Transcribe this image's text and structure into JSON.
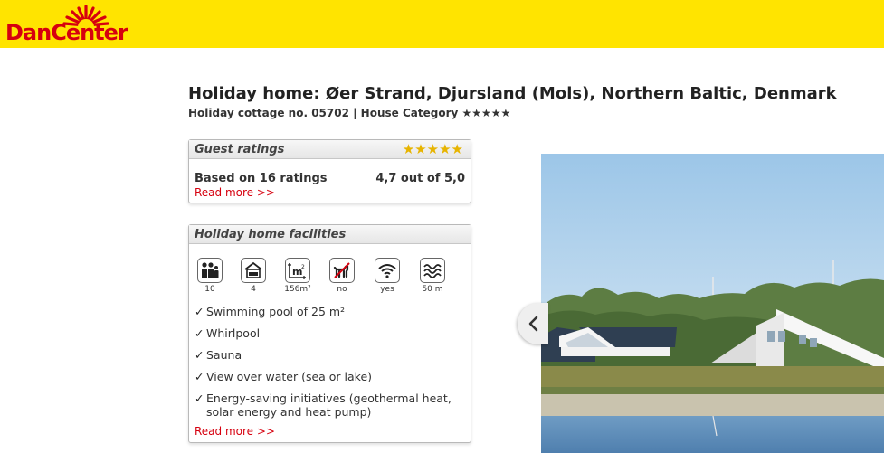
{
  "brand": {
    "name": "DanCenter",
    "color": "#d6000f",
    "bar_color": "#ffe400"
  },
  "property": {
    "title": "Holiday home: Øer Strand, Djursland (Mols), Northern Baltic, Denmark",
    "subtitle": "Holiday cottage no. 05702 | House Category ★★★★★"
  },
  "ratings": {
    "heading": "Guest ratings",
    "stars": "★★★★★",
    "star_color": "#e7b400",
    "based_on": "Based on 16 ratings",
    "score": "4,7 out of 5,0",
    "read_more": "Read more >>"
  },
  "facilities": {
    "heading": "Holiday home facilities",
    "icons": [
      {
        "icon": "persons-icon",
        "value": "10"
      },
      {
        "icon": "bedroom-icon",
        "value": "4"
      },
      {
        "icon": "area-icon",
        "value": "156m²"
      },
      {
        "icon": "no-pets-icon",
        "value": "no"
      },
      {
        "icon": "wifi-icon",
        "value": "yes"
      },
      {
        "icon": "water-distance-icon",
        "value": "50 m"
      }
    ],
    "area_icon_label": "m",
    "area_icon_sup": "2",
    "items": [
      "Swimming pool of 25 m²",
      "Whirlpool",
      "Sauna",
      "View over water (sea or lake)",
      "Energy-saving initiatives (geothermal heat, solar energy and heat pump)"
    ],
    "tick": "✓",
    "read_more": "Read more >>"
  },
  "gallery": {
    "prev_icon": "chevron-left-icon"
  }
}
